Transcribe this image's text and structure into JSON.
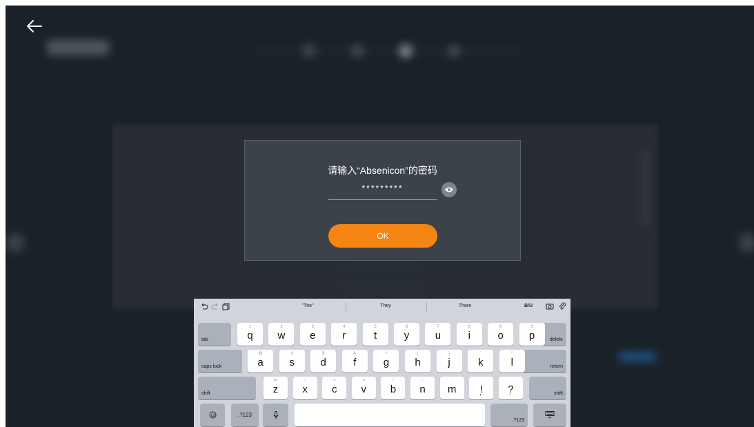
{
  "background": {
    "blurred": true
  },
  "dialog": {
    "title": "请输入“Absenicon”的密码",
    "password_value": "*********",
    "ok_label": "OK"
  },
  "keyboard": {
    "toolbar": {
      "suggestions": [
        "\"The\"",
        "They",
        "There"
      ],
      "format_label": "B/U"
    },
    "row1": {
      "special_left": "tab",
      "keys": [
        {
          "main": "q",
          "hint": "1"
        },
        {
          "main": "w",
          "hint": "2"
        },
        {
          "main": "e",
          "hint": "3"
        },
        {
          "main": "r",
          "hint": "4"
        },
        {
          "main": "t",
          "hint": "5"
        },
        {
          "main": "y",
          "hint": "6"
        },
        {
          "main": "u",
          "hint": "7"
        },
        {
          "main": "i",
          "hint": "8"
        },
        {
          "main": "o",
          "hint": "9"
        },
        {
          "main": "p",
          "hint": "0"
        }
      ],
      "special_right": "delete"
    },
    "row2": {
      "special_left": "caps lock",
      "keys": [
        {
          "main": "a",
          "hint": "@"
        },
        {
          "main": "s",
          "hint": "#"
        },
        {
          "main": "d",
          "hint": "$"
        },
        {
          "main": "f",
          "hint": "&"
        },
        {
          "main": "g",
          "hint": "*"
        },
        {
          "main": "h",
          "hint": "("
        },
        {
          "main": "j",
          "hint": ")"
        },
        {
          "main": "k",
          "hint": "'"
        },
        {
          "main": "l",
          "hint": "\""
        }
      ],
      "special_right": "return"
    },
    "row3": {
      "special_left": "shift",
      "keys": [
        {
          "main": "z",
          "hint": "%"
        },
        {
          "main": "x",
          "hint": "-"
        },
        {
          "main": "c",
          "hint": "+"
        },
        {
          "main": "v",
          "hint": "="
        },
        {
          "main": "b",
          "hint": "/"
        },
        {
          "main": "n",
          "hint": ";"
        },
        {
          "main": "m",
          "hint": ":"
        },
        {
          "main": "!",
          "hint": ""
        },
        {
          "main": "?",
          "hint": ""
        }
      ],
      "punct_sub": [
        ",",
        "."
      ],
      "special_right": "shift"
    },
    "row4": {
      "numbers_left": ".?123",
      "numbers_right": ".?123"
    }
  },
  "colors": {
    "screen_bg": "#1b2128",
    "dialog_bg": "#3b4249",
    "accent": "#f58413",
    "keyboard_bg": "#d1d4da"
  },
  "icons": [
    "back-arrow-icon",
    "eye-icon",
    "undo-icon",
    "redo-icon",
    "paste-icon",
    "camera-icon",
    "paperclip-icon",
    "emoji-icon",
    "microphone-icon",
    "keyboard-hide-icon"
  ]
}
